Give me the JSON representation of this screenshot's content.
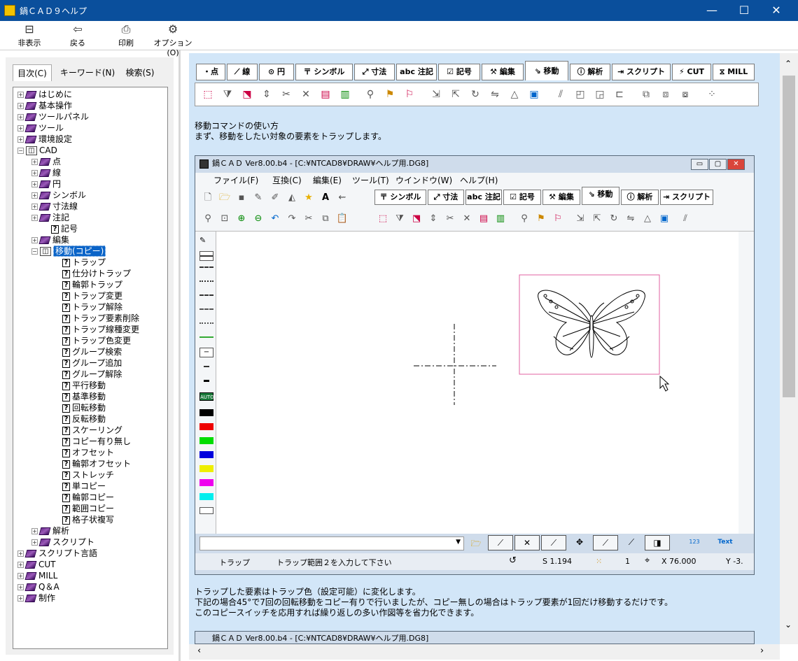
{
  "window": {
    "title": "鍋ＣＡＤ９ヘルプ",
    "minimize": "—",
    "maximize": "☐",
    "close": "✕"
  },
  "toolbar": {
    "hide": "非表示",
    "back": "戻る",
    "print": "印刷",
    "options": "オプション(O)"
  },
  "left_tabs": {
    "contents": "目次(C)",
    "keyword": "キーワード(N)",
    "search": "検索(S)"
  },
  "tree": [
    {
      "label": "はじめに"
    },
    {
      "label": "基本操作"
    },
    {
      "label": "ツールパネル"
    },
    {
      "label": "ツール"
    },
    {
      "label": "環境設定"
    },
    {
      "label": "CAD"
    },
    {
      "label": "点"
    },
    {
      "label": "線"
    },
    {
      "label": "円"
    },
    {
      "label": "シンボル"
    },
    {
      "label": "寸法線"
    },
    {
      "label": "注記"
    },
    {
      "label": "記号"
    },
    {
      "label": "編集"
    },
    {
      "label": "移動(コピー)"
    },
    {
      "label": "トラップ"
    },
    {
      "label": "仕分けトラップ"
    },
    {
      "label": "輪郭トラップ"
    },
    {
      "label": "トラップ変更"
    },
    {
      "label": "トラップ解除"
    },
    {
      "label": "トラップ要素削除"
    },
    {
      "label": "トラップ線種変更"
    },
    {
      "label": "トラップ色変更"
    },
    {
      "label": "グループ検索"
    },
    {
      "label": "グループ追加"
    },
    {
      "label": "グループ解除"
    },
    {
      "label": "平行移動"
    },
    {
      "label": "基準移動"
    },
    {
      "label": "回転移動"
    },
    {
      "label": "反転移動"
    },
    {
      "label": "スケーリング"
    },
    {
      "label": "コピー有り無し"
    },
    {
      "label": "オフセット"
    },
    {
      "label": "輪郭オフセット"
    },
    {
      "label": "ストレッチ"
    },
    {
      "label": "単コピー"
    },
    {
      "label": "輪郭コピー"
    },
    {
      "label": "範囲コピー"
    },
    {
      "label": "格子状複写"
    },
    {
      "label": "解析"
    },
    {
      "label": "スクリプト"
    },
    {
      "label": "スクリプト言語"
    },
    {
      "label": "CUT"
    },
    {
      "label": "MILL"
    },
    {
      "label": "Q＆A"
    },
    {
      "label": "制作"
    }
  ],
  "cmd_tabs": [
    "・点",
    "⟋ 線",
    "⊙ 円",
    "〒 シンボル",
    "⤢ 寸法",
    "abc 注記",
    "☑ 記号",
    "⚒ 編集",
    "⇘ 移動",
    "ⓘ 解析",
    "⇥ スクリプト",
    "⚡ CUT",
    "⧖ MILL"
  ],
  "text": {
    "intro1": "移動コマンドの使い方",
    "intro2": "まず、移動をしたい対象の要素をトラップします。",
    "body1": "トラップした要素はトラップ色（設定可能）に変化します。",
    "body2": "下記の場合45°で7回の回転移動をコピー有りで行いましたが、コピー無しの場合はトラップ要素が1回だけ移動するだけです。",
    "body3": "このコピースイッチを応用すれば繰り返しの多い作図等を省力化できます。"
  },
  "app": {
    "title": "鍋ＣＡＤ Ver8.00.b4 - [C:¥NTCAD8¥DRAW¥ヘルプ用.DG8]",
    "menu": [
      "ファイル(F)",
      "互換(C)",
      "編集(E)",
      "ツール(T)",
      "ウインドウ(W)",
      "ヘルプ(H)"
    ],
    "tabs": [
      "〒 シンボル",
      "⤢ 寸法",
      "abc 注記",
      "☑ 記号",
      "⚒ 編集",
      "⇘ 移動",
      "ⓘ 解析",
      "⇥ スクリプト"
    ],
    "palette_auto": "AUTO",
    "status_mode": "トラップ",
    "status_msg": "トラップ範囲２を入力して下さい",
    "status_scale": "S 1.194",
    "status_layer": "1",
    "status_x": "X 76.000",
    "status_y": "Y -3.",
    "text_btn": "Text",
    "num_btn": "123"
  },
  "app2_title": "鍋ＣＡＤ Ver8.00.b4 - [C:¥NTCAD8¥DRAW¥ヘルプ用.DG8]"
}
